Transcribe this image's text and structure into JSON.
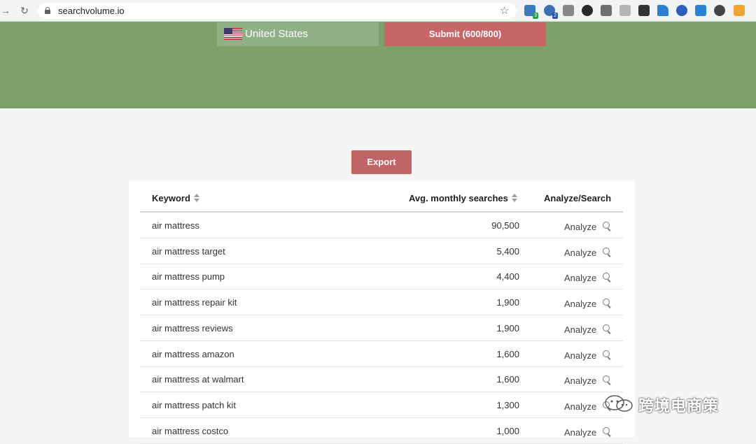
{
  "browser": {
    "url": "searchvolume.io",
    "ext_badges": [
      "3",
      "2"
    ]
  },
  "banner": {
    "country": "United States",
    "submit_label": "Submit (600/800)"
  },
  "export_label": "Export",
  "table": {
    "headers": {
      "keyword": "Keyword",
      "volume": "Avg. monthly searches",
      "analyze": "Analyze/Search"
    },
    "rows": [
      {
        "keyword": "air mattress",
        "volume": "90,500",
        "action": "Analyze"
      },
      {
        "keyword": "air mattress target",
        "volume": "5,400",
        "action": "Analyze"
      },
      {
        "keyword": "air mattress pump",
        "volume": "4,400",
        "action": "Analyze"
      },
      {
        "keyword": "air mattress repair kit",
        "volume": "1,900",
        "action": "Analyze"
      },
      {
        "keyword": "air mattress reviews",
        "volume": "1,900",
        "action": "Analyze"
      },
      {
        "keyword": "air mattress amazon",
        "volume": "1,600",
        "action": "Analyze"
      },
      {
        "keyword": "air mattress at walmart",
        "volume": "1,600",
        "action": "Analyze"
      },
      {
        "keyword": "air mattress patch kit",
        "volume": "1,300",
        "action": "Analyze"
      },
      {
        "keyword": "air mattress costco",
        "volume": "1,000",
        "action": "Analyze"
      }
    ]
  },
  "watermark": "跨境电商策",
  "colors": {
    "banner": "#7f9f6b",
    "submit": "#c76667",
    "export": "#c06565"
  }
}
